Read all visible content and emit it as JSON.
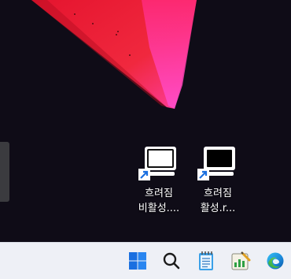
{
  "desktop": {
    "icons": [
      {
        "line1": "흐려짐",
        "line2": "비활성....",
        "icon": "monitor-shortcut-icon"
      },
      {
        "line1": "흐려짐",
        "line2": "활성.r...",
        "icon": "monitor-shortcut-icon"
      }
    ]
  },
  "taskbar": {
    "buttons": [
      {
        "name": "start-button",
        "icon": "windows-logo-icon"
      },
      {
        "name": "search-button",
        "icon": "search-icon"
      },
      {
        "name": "notepad-button",
        "icon": "notepad-icon"
      },
      {
        "name": "chart-app-button",
        "icon": "chart-app-icon"
      },
      {
        "name": "edge-button",
        "icon": "edge-icon"
      }
    ]
  },
  "colors": {
    "wallpaper_dark": "#0f0c17",
    "wallpaper_red": "#f0283e",
    "wallpaper_pink": "#ff3fae",
    "taskbar": "#eef0f6",
    "windows_blue": "#1a6fe0"
  }
}
